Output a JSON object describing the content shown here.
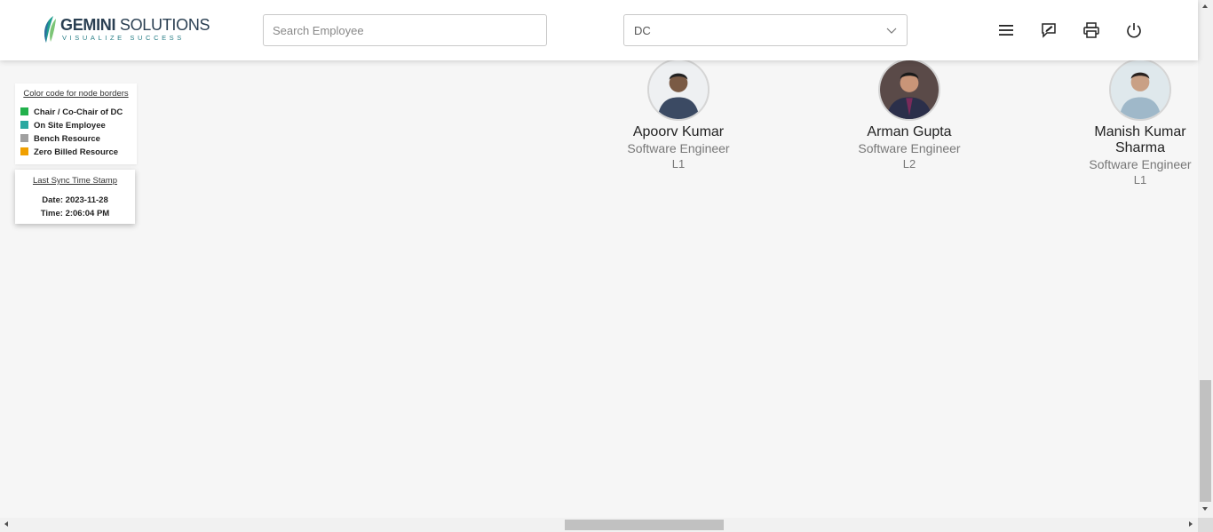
{
  "header": {
    "logo_name_bold": "GEMINI",
    "logo_name_rest": " SOLUTIONS",
    "logo_tagline": "VISUALIZE SUCCESS",
    "search_placeholder": "Search Employee",
    "search_value": "",
    "dropdown_value": "DC",
    "icons": [
      "menu-icon",
      "feedback-icon",
      "print-icon",
      "power-icon"
    ]
  },
  "legend": {
    "title": "Color code for node borders",
    "items": [
      {
        "label": "Chair / Co-Chair of DC",
        "color": "#22b14c"
      },
      {
        "label": "On Site Employee",
        "color": "#2aa8a0"
      },
      {
        "label": "Bench Resource",
        "color": "#a0a0a0"
      },
      {
        "label": "Zero Billed Resource",
        "color": "#f0a000"
      }
    ]
  },
  "sync": {
    "title": "Last Sync Time Stamp",
    "date_line": "Date: 2023-11-28",
    "time_line": "Time: 2:06:04 PM"
  },
  "employees": [
    {
      "name": "Apoorv Kumar",
      "role": "Software Engineer",
      "level": "L1"
    },
    {
      "name": "Arman Gupta",
      "role": "Software Engineer",
      "level": "L2"
    },
    {
      "name": "Manish Kumar Sharma",
      "role": "Software Engineer",
      "level": "L1"
    }
  ],
  "colors": {
    "accent": "#2a7f87",
    "brand_dark": "#2a3f52"
  }
}
